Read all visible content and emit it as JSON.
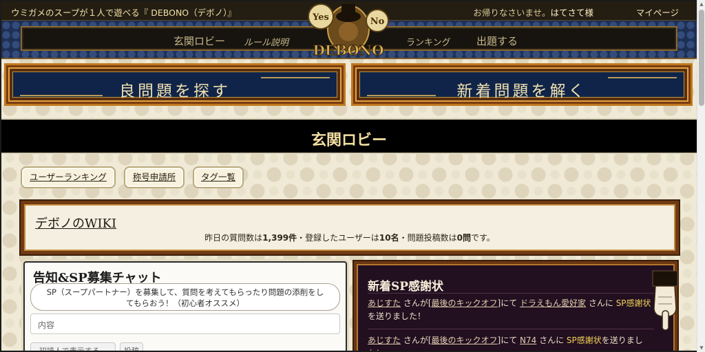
{
  "header": {
    "site_title": "ウミガメのスープが１人で遊べる『 DEBONO（デボノ）』",
    "welcome_prefix": "お帰りなさいませ。",
    "username": "はてさて様",
    "mypage": "マイページ"
  },
  "logo": {
    "yes": "Yes",
    "no": "No",
    "name": "DEBONO"
  },
  "nav": {
    "lobby": "玄関ロビー",
    "rules": "ルール説明",
    "ranking": "ランキング",
    "post": "出題する"
  },
  "big_buttons": {
    "search": "良問題を探す",
    "solve": "新着問題を解く"
  },
  "lobby": {
    "title": "玄関ロビー"
  },
  "small_buttons": {
    "user_ranking": "ユーザーランキング",
    "title_apply": "称号申請所",
    "tag_list": "タグ一覧"
  },
  "wiki": {
    "title": "デボノのWIKI",
    "stats_prefix": "昨日の質問数は",
    "questions": "1,399件",
    "stats_mid1": "・登録したユーザーは",
    "users": "10名",
    "stats_mid2": "・問題投稿数は",
    "posts": "0問",
    "stats_suffix": "です。"
  },
  "chat": {
    "title": "告知&SP募集チャット",
    "message": "SP（スープパートナー）を募集して、質問を考えてもらったり問題の添削をしてもらおう！（初心者オススメ）",
    "input_placeholder": "内容",
    "button1": "初読人で表示する...",
    "button2": "投稿"
  },
  "sp": {
    "title": "新着SP感謝状",
    "entries": [
      {
        "user": "あじすた",
        "t1": " さんが[",
        "problem": "最後のキックオフ",
        "t2": "]にて ",
        "target": "ドラえもん愛好家",
        "t3": " さんに ",
        "award": "SP感謝状",
        "t4": "を送りました！"
      },
      {
        "user": "あじすた",
        "t1": " さんが[",
        "problem": "最後のキックオフ",
        "t2": "]にて ",
        "target": "N74",
        "t3": " さんに ",
        "award": "SP感謝状",
        "t4": "を送りました！"
      }
    ]
  },
  "colors": {
    "accent_gold": "#f0e0a8",
    "nav_blue": "#1e2f55",
    "frame_brown": "#6f3a14",
    "sp_bg": "#220f20",
    "highlight_yellow": "#f3d35a"
  }
}
